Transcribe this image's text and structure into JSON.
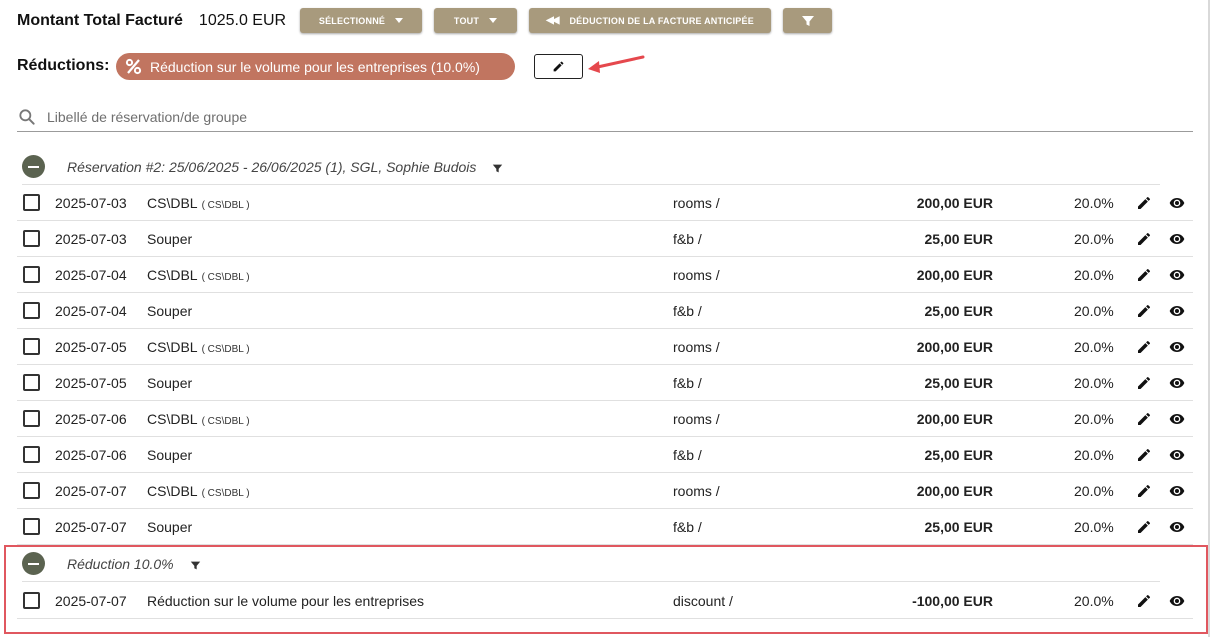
{
  "header": {
    "title": "Montant Total Facturé",
    "total": "1025.0 EUR",
    "btn_selected": "SÉLECTIONNÉ",
    "btn_all": "TOUT",
    "btn_deduction": "DÉDUCTION DE LA FACTURE ANTICIPÉE",
    "filter_icon": "filter-icon"
  },
  "reductions": {
    "label": "Réductions:",
    "chip_label": "Réduction sur le volume pour les entreprises (10.0%)",
    "chip_icon": "percent-icon",
    "edit_icon": "pencil-icon"
  },
  "search": {
    "placeholder": "Libellé de réservation/de groupe",
    "icon": "search-icon"
  },
  "groups": [
    {
      "title": "Réservation #2: 25/06/2025 - 26/06/2025 (1), SGL, Sophie Budois",
      "rows": [
        {
          "date": "2025-07-03",
          "desc": "CS\\DBL",
          "code": "( CS\\DBL )",
          "type": "rooms /",
          "amount": "200,00 EUR",
          "pct": "20.0%"
        },
        {
          "date": "2025-07-03",
          "desc": "Souper",
          "code": "",
          "type": "f&b /",
          "amount": "25,00 EUR",
          "pct": "20.0%"
        },
        {
          "date": "2025-07-04",
          "desc": "CS\\DBL",
          "code": "( CS\\DBL )",
          "type": "rooms /",
          "amount": "200,00 EUR",
          "pct": "20.0%"
        },
        {
          "date": "2025-07-04",
          "desc": "Souper",
          "code": "",
          "type": "f&b /",
          "amount": "25,00 EUR",
          "pct": "20.0%"
        },
        {
          "date": "2025-07-05",
          "desc": "CS\\DBL",
          "code": "( CS\\DBL )",
          "type": "rooms /",
          "amount": "200,00 EUR",
          "pct": "20.0%"
        },
        {
          "date": "2025-07-05",
          "desc": "Souper",
          "code": "",
          "type": "f&b /",
          "amount": "25,00 EUR",
          "pct": "20.0%"
        },
        {
          "date": "2025-07-06",
          "desc": "CS\\DBL",
          "code": "( CS\\DBL )",
          "type": "rooms /",
          "amount": "200,00 EUR",
          "pct": "20.0%"
        },
        {
          "date": "2025-07-06",
          "desc": "Souper",
          "code": "",
          "type": "f&b /",
          "amount": "25,00 EUR",
          "pct": "20.0%"
        },
        {
          "date": "2025-07-07",
          "desc": "CS\\DBL",
          "code": "( CS\\DBL )",
          "type": "rooms /",
          "amount": "200,00 EUR",
          "pct": "20.0%"
        },
        {
          "date": "2025-07-07",
          "desc": "Souper",
          "code": "",
          "type": "f&b /",
          "amount": "25,00 EUR",
          "pct": "20.0%"
        }
      ]
    },
    {
      "title": "Réduction 10.0%",
      "rows": [
        {
          "date": "2025-07-07",
          "desc": "Réduction sur le volume pour les entreprises",
          "code": "",
          "type": "discount /",
          "amount": "-100,00 EUR",
          "pct": "20.0%"
        }
      ]
    }
  ],
  "colors": {
    "button": "#a89a7d",
    "chip": "#c17560",
    "collapse": "#5b6350",
    "highlight": "#e0575f"
  }
}
